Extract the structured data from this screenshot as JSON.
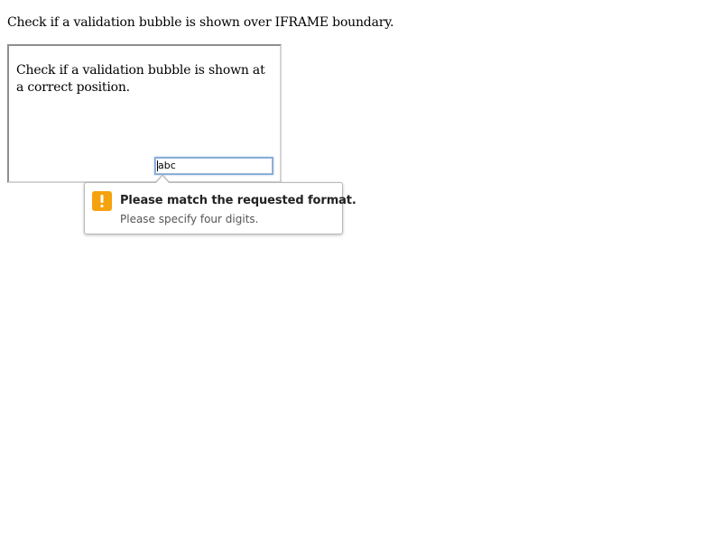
{
  "page": {
    "heading": "Check if a validation bubble is shown over IFRAME boundary."
  },
  "iframe": {
    "text": "Check if a validation bubble is shown at a correct position.",
    "input": {
      "value": "abc",
      "placeholder": ""
    }
  },
  "validation_bubble": {
    "title": "Please match the requested format.",
    "message": "Please specify four digits.",
    "icon": "warning-icon",
    "icon_color": "#f5a20f"
  }
}
